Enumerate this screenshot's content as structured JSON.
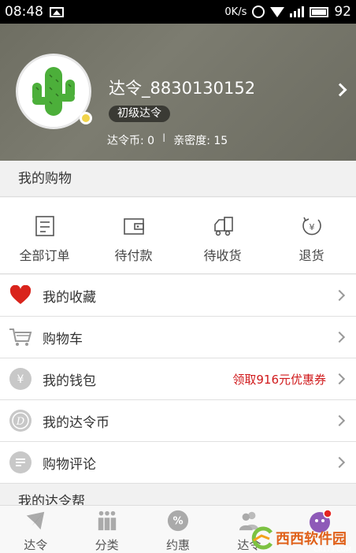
{
  "status_bar": {
    "time": "08:48",
    "network_speed": "0K/s",
    "battery": "92"
  },
  "profile": {
    "username": "达令_8830130152",
    "level": "初级达令",
    "coins": "达令币: 0",
    "separator": "I",
    "intimacy": "亲密度: 15"
  },
  "shopping_section": {
    "title": "我的购物"
  },
  "orders": [
    {
      "label": "全部订单",
      "icon": "order-list-icon"
    },
    {
      "label": "待付款",
      "icon": "wallet-icon"
    },
    {
      "label": "待收货",
      "icon": "delivery-truck-icon"
    },
    {
      "label": "退货",
      "icon": "return-yen-icon"
    }
  ],
  "menu": [
    {
      "label": "我的收藏",
      "icon": "heart-icon",
      "extra": ""
    },
    {
      "label": "购物车",
      "icon": "cart-icon",
      "extra": ""
    },
    {
      "label": "我的钱包",
      "icon": "yen-coin-icon",
      "extra": "领取916元优惠券"
    },
    {
      "label": "我的达令币",
      "icon": "d-coin-icon",
      "extra": ""
    },
    {
      "label": "购物评论",
      "icon": "comment-icon",
      "extra": ""
    }
  ],
  "helper_section": {
    "title": "我的达令帮"
  },
  "tabs": [
    {
      "label": "达令",
      "icon": "home-plane-icon"
    },
    {
      "label": "分类",
      "icon": "category-icon"
    },
    {
      "label": "约惠",
      "icon": "discount-icon"
    },
    {
      "label": "达令",
      "icon": "people-icon"
    },
    {
      "label": "",
      "icon": "face-icon"
    }
  ],
  "colors": {
    "accent_red": "#d0191b",
    "cactus_green": "#4caf3a",
    "header_bg": "#75756a"
  },
  "watermark": {
    "text": "西西软件园",
    "url": "CR173.COM"
  }
}
